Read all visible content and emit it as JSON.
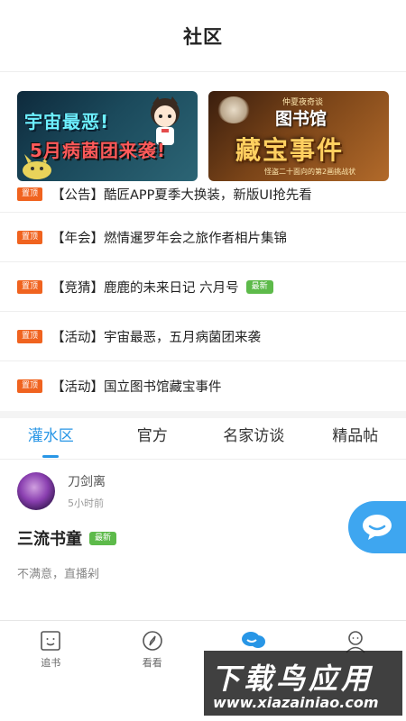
{
  "header": {
    "title": "社区"
  },
  "banners": [
    {
      "line1": "宇宙最恶!",
      "line2": "5月病菌团来袭!"
    },
    {
      "small": "仲夏夜奇谈",
      "title": "图书馆",
      "main": "藏宝事件",
      "sub": "怪盗二十面向的第2画挑战状"
    }
  ],
  "notices": [
    {
      "pin": "置顶",
      "text": "【公告】酷匠APP夏季大换装，新版UI抢先看",
      "badge": ""
    },
    {
      "pin": "置顶",
      "text": "【年会】燃情暹罗年会之旅作者相片集锦",
      "badge": ""
    },
    {
      "pin": "置顶",
      "text": "【竞猜】鹿鹿的未来日记 六月号",
      "badge": "最新"
    },
    {
      "pin": "置顶",
      "text": "【活动】宇宙最恶，五月病菌团来袭",
      "badge": ""
    },
    {
      "pin": "置顶",
      "text": "【活动】国立图书馆藏宝事件",
      "badge": ""
    }
  ],
  "tabs": [
    "灌水区",
    "官方",
    "名家访谈",
    "精品帖"
  ],
  "post": {
    "username": "刀剑离",
    "time": "5小时前",
    "title": "三流书童",
    "badge": "最新",
    "snippet": "不满意，直播剁"
  },
  "tabbar": [
    {
      "label": "追书",
      "icon": "face-book-icon"
    },
    {
      "label": "看看",
      "icon": "compass-icon"
    },
    {
      "label": "",
      "icon": "chat-bubbles-icon"
    },
    {
      "label": "",
      "icon": "user-icon"
    }
  ],
  "watermark": {
    "main": "下载鸟应用",
    "url": "www.xiazainiao.com"
  },
  "colors": {
    "accent": "#2896e6",
    "pin": "#f0631f",
    "new": "#5dba4a"
  }
}
